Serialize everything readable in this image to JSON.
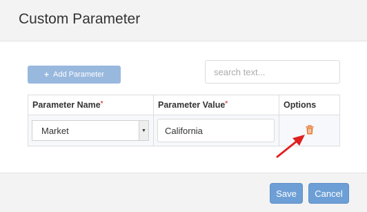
{
  "dialog": {
    "title": "Custom Parameter"
  },
  "toolbar": {
    "add_label": "Add Parameter",
    "add_icon": "plus-icon",
    "search_placeholder": "search text..."
  },
  "table": {
    "headers": {
      "name": "Parameter Name",
      "value": "Parameter Value",
      "options": "Options"
    },
    "required_mark": "*",
    "rows": [
      {
        "name": "Market",
        "value": "California",
        "option_icon": "trash-icon"
      }
    ]
  },
  "footer": {
    "save_label": "Save",
    "cancel_label": "Cancel"
  },
  "colors": {
    "primary_button": "#6d9fd6",
    "disabled_button": "#98b8de",
    "delete_icon": "#e8772e",
    "annotation_arrow": "#e02020"
  }
}
